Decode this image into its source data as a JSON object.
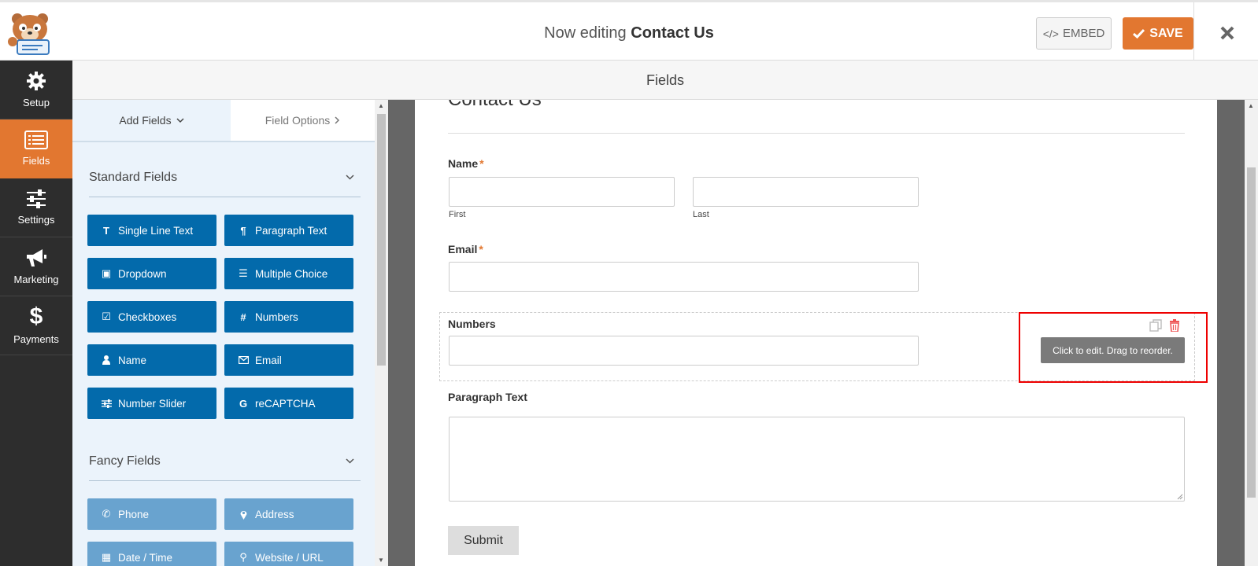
{
  "header": {
    "title_prefix": "Now editing",
    "title_form": "Contact Us",
    "embed_label": "EMBED",
    "save_label": "SAVE"
  },
  "nav": {
    "items": [
      {
        "label": "Setup",
        "icon": "gear-icon"
      },
      {
        "label": "Fields",
        "icon": "list-icon",
        "active": true
      },
      {
        "label": "Settings",
        "icon": "sliders-icon"
      },
      {
        "label": "Marketing",
        "icon": "megaphone-icon"
      },
      {
        "label": "Payments",
        "icon": "dollar-icon"
      }
    ]
  },
  "section_title": "Fields",
  "panel": {
    "tab_add": "Add Fields",
    "tab_options": "Field Options",
    "standard_title": "Standard Fields",
    "fancy_title": "Fancy Fields",
    "standard_fields": [
      "Single Line Text",
      "Paragraph Text",
      "Dropdown",
      "Multiple Choice",
      "Checkboxes",
      "Numbers",
      "Name",
      "Email",
      "Number Slider",
      "reCAPTCHA"
    ],
    "fancy_fields": [
      "Phone",
      "Address",
      "Date / Time",
      "Website / URL"
    ]
  },
  "form": {
    "title": "Contact Us",
    "name_label": "Name",
    "required_mark": "*",
    "first_label": "First",
    "last_label": "Last",
    "email_label": "Email",
    "numbers_label": "Numbers",
    "tooltip": "Click to edit. Drag to reorder.",
    "paragraph_label": "Paragraph Text",
    "submit_label": "Submit"
  },
  "colors": {
    "accent": "#e27730",
    "field_button": "#036aab",
    "fancy_button": "#69a3cf",
    "nav_bg": "#2d2d2d",
    "highlight": "#e00000"
  }
}
